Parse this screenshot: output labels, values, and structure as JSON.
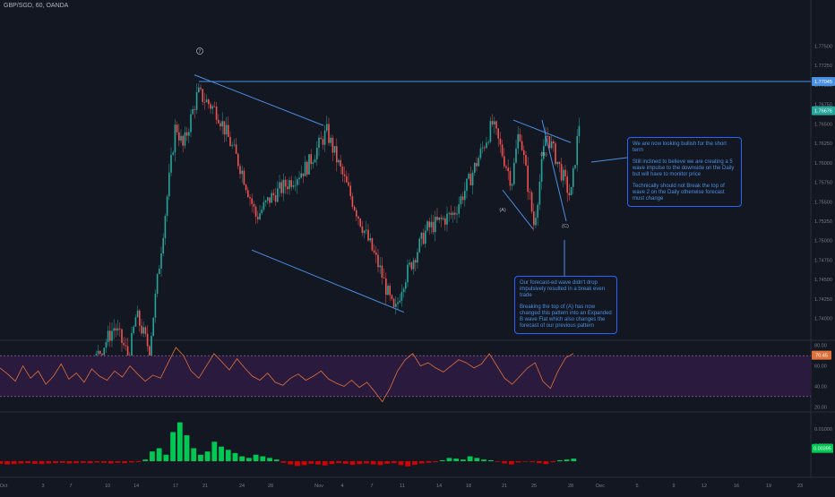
{
  "header": {
    "symbol_text": "GBP/SGD, 60, OANDA"
  },
  "notes": {
    "right": [
      "We are now looking bullish for the short term",
      "Still inclined to believe we are creating a 5 wave impulse to the downside on the Daily but will have to monitor price",
      "Technically should not Break the top of wave 2 on the Daily otherwise forecast must change"
    ],
    "bottom": [
      "Our forecast-ed wave didn't drop impulsively resulted in a break even trade",
      "Breaking the top of (A) has now changed this pattern into an Expanded B wave Flat which also changes the forecast of our previous pattern"
    ]
  },
  "wave_labels": {
    "circle": "7",
    "A": "(A)",
    "B": "(B)",
    "C": "(C)"
  },
  "price_tags": {
    "level": "1.77045",
    "current": "1.76676",
    "rsi": "70.45",
    "macd": "0.00395"
  },
  "colors": {
    "background": "#131722",
    "up": "#26a69a",
    "down": "#ef5350",
    "trendline": "#4a90e2",
    "rsi_line": "#e0713a",
    "rsi_band": "#2a1a3d",
    "macd_up": "#00c853",
    "macd_down": "#d50000"
  },
  "chart_data": [
    {
      "type": "candlestick",
      "pair": "GBP/SGD",
      "timeframe": "60",
      "source": "OANDA",
      "y_axis_ticks": [
        1.775,
        1.7725,
        1.77,
        1.7675,
        1.765,
        1.7625,
        1.76,
        1.7575,
        1.755,
        1.7525,
        1.75,
        1.7475,
        1.745,
        1.7425,
        1.74
      ],
      "ylim": [
        1.7372,
        1.78
      ],
      "x_axis_ticks": [
        "Oct",
        "3",
        "7",
        "10",
        "14",
        "17",
        "21",
        "24",
        "28",
        "Nov",
        "4",
        "7",
        "11",
        "14",
        "18",
        "21",
        "25",
        "28",
        "Dec",
        "5",
        "9",
        "12",
        "16",
        "19",
        "23"
      ],
      "horizontal_level": 1.77045,
      "path_points": [
        {
          "x": "Oct 1",
          "y": 1.7325
        },
        {
          "x": "Oct 8",
          "y": 1.732
        },
        {
          "x": "Oct 11",
          "y": 1.739
        },
        {
          "x": "Oct 13",
          "y": 1.735
        },
        {
          "x": "Oct 14",
          "y": 1.7405
        },
        {
          "x": "Oct 15",
          "y": 1.736
        },
        {
          "x": "Oct 17",
          "y": 1.765
        },
        {
          "x": "Oct 18",
          "y": 1.762
        },
        {
          "x": "Oct 20",
          "y": 1.769
        },
        {
          "x": "Oct 22",
          "y": 1.7665
        },
        {
          "x": "Oct 24",
          "y": 1.759
        },
        {
          "x": "Oct 26",
          "y": 1.753
        },
        {
          "x": "Oct 28",
          "y": 1.7555
        },
        {
          "x": "Oct 31",
          "y": 1.7595
        },
        {
          "x": "Nov 2",
          "y": 1.764
        },
        {
          "x": "Nov 4",
          "y": 1.7585
        },
        {
          "x": "Nov 6",
          "y": 1.752
        },
        {
          "x": "Nov 8",
          "y": 1.7465
        },
        {
          "x": "Nov 10",
          "y": 1.7405
        },
        {
          "x": "Nov 11",
          "y": 1.7445
        },
        {
          "x": "Nov 13",
          "y": 1.7515
        },
        {
          "x": "Nov 16",
          "y": 1.7535
        },
        {
          "x": "Nov 18",
          "y": 1.7575
        },
        {
          "x": "Nov 20",
          "y": 1.765
        },
        {
          "x": "Nov 22",
          "y": 1.7575
        },
        {
          "x": "Nov 23",
          "y": 1.7645
        },
        {
          "x": "Nov 25",
          "y": 1.752
        },
        {
          "x": "Nov 26",
          "y": 1.764
        },
        {
          "x": "Nov 28",
          "y": 1.7555
        },
        {
          "x": "Nov 29",
          "y": 1.7667
        }
      ]
    },
    {
      "type": "line",
      "name": "RSI",
      "y_axis_ticks": [
        80,
        60,
        40,
        20
      ],
      "band": [
        70,
        30
      ],
      "values": [
        58,
        52,
        45,
        60,
        48,
        55,
        42,
        50,
        62,
        47,
        53,
        44,
        57,
        50,
        46,
        55,
        49,
        60,
        52,
        45,
        51,
        48,
        63,
        78,
        70,
        55,
        48,
        60,
        72,
        64,
        56,
        67,
        58,
        50,
        46,
        53,
        44,
        41,
        48,
        52,
        46,
        50,
        55,
        47,
        43,
        40,
        46,
        39,
        44,
        35,
        25,
        38,
        55,
        66,
        72,
        60,
        63,
        58,
        54,
        60,
        66,
        63,
        58,
        62,
        72,
        60,
        48,
        42,
        50,
        58,
        63,
        45,
        38,
        55,
        68,
        72
      ]
    },
    {
      "type": "histogram",
      "name": "MACD",
      "y_axis_ticks": [
        0.01,
        0.005
      ],
      "values": [
        -0.0008,
        -0.001,
        -0.0009,
        -0.0007,
        -0.0006,
        -0.0008,
        -0.0009,
        -0.0007,
        -0.0006,
        -0.0005,
        -0.0007,
        -0.0006,
        -0.0005,
        -0.0006,
        -0.0004,
        -0.0005,
        -0.0007,
        -0.0005,
        -0.0006,
        -0.0004,
        -0.0003,
        0.0005,
        0.003,
        0.004,
        0.002,
        0.009,
        0.012,
        0.008,
        0.004,
        0.002,
        0.003,
        0.006,
        0.0045,
        0.0035,
        0.0025,
        0.0015,
        0.001,
        0.002,
        0.0015,
        0.001,
        0.0005,
        -0.0005,
        -0.001,
        -0.0015,
        -0.0012,
        -0.0008,
        -0.001,
        -0.0013,
        -0.0009,
        -0.0006,
        -0.0008,
        -0.0011,
        -0.0009,
        -0.0007,
        -0.001,
        -0.0012,
        -0.0008,
        -0.0006,
        -0.0012,
        -0.0016,
        -0.0011,
        -0.0007,
        -0.0005,
        -0.0003,
        0.0003,
        0.001,
        0.0008,
        0.0005,
        0.0015,
        0.001,
        0.0005,
        0.0003,
        -0.0002,
        -0.0007,
        -0.001,
        -0.0004,
        -0.0002,
        -0.0003,
        -0.0006,
        -0.0009,
        -0.0003,
        0.0003,
        0.0005,
        0.0008
      ]
    }
  ]
}
